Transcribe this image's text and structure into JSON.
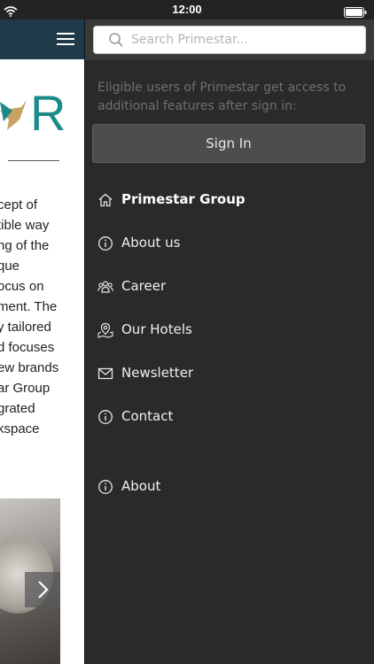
{
  "status_bar": {
    "time": "12:00"
  },
  "page": {
    "body_lines": [
      "cept of",
      "tible way",
      "ng of the",
      "que",
      "ocus on",
      "ment. The",
      "y tailored",
      "d focuses",
      "ew brands",
      "ar Group",
      "grated",
      "kspace"
    ],
    "logo_letter": "R"
  },
  "drawer": {
    "search": {
      "placeholder": "Search Primestar..."
    },
    "info_text": "Eligible users of Primestar get access to additional features after sign in:",
    "signin_label": "Sign In",
    "menu": [
      {
        "label": "Primestar Group",
        "icon": "home-icon",
        "active": true
      },
      {
        "label": "About us",
        "icon": "info-icon"
      },
      {
        "label": "Career",
        "icon": "people-icon"
      },
      {
        "label": "Our Hotels",
        "icon": "map-pin-icon"
      },
      {
        "label": "Newsletter",
        "icon": "mail-icon"
      },
      {
        "label": "Contact",
        "icon": "info-icon"
      }
    ],
    "about_label": "About"
  },
  "colors": {
    "drawer_bg": "#2a2a2a",
    "header_bg": "#1f3b4a",
    "logo_teal": "#1d8a8a",
    "logo_gold": "#c9a160"
  }
}
